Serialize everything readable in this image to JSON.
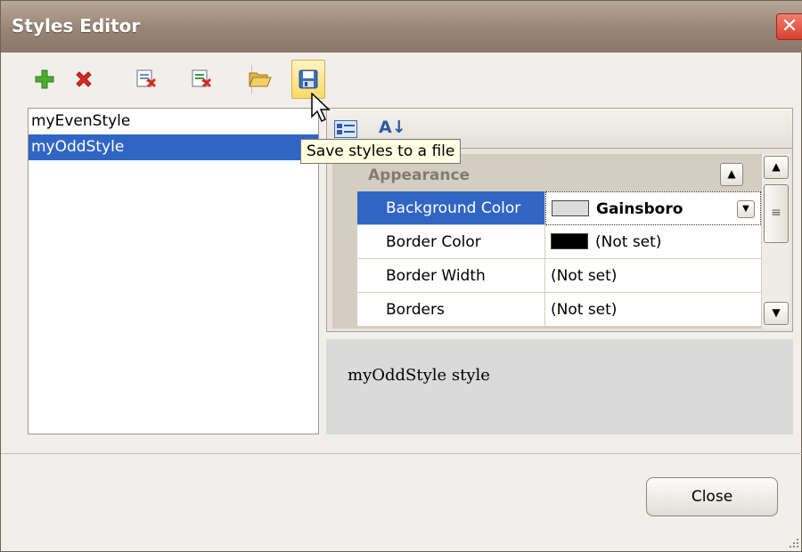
{
  "window": {
    "title": "Styles Editor",
    "close_glyph": "✕"
  },
  "toolbar": {
    "buttons": [
      {
        "name": "add-style",
        "icon": "plus-icon"
      },
      {
        "name": "delete-style",
        "icon": "red-x-icon"
      },
      {
        "name": "purge-styles",
        "icon": "purge-icon"
      },
      {
        "name": "clear-styles",
        "icon": "clear-icon"
      },
      {
        "name": "load-styles",
        "icon": "open-folder-icon"
      },
      {
        "name": "save-styles",
        "icon": "floppy-disk-icon"
      }
    ]
  },
  "style_list": {
    "items": [
      "myEvenStyle",
      "myOddStyle"
    ],
    "selected": "myOddStyle"
  },
  "property_grid": {
    "toolbar": {
      "categorized_icon": "categorized-icon",
      "alphabetical_label": "A↓"
    },
    "category": "Appearance",
    "rows": [
      {
        "name": "Background Color",
        "value": "Gainsboro",
        "swatch": "#dcdcdc",
        "selected": true
      },
      {
        "name": "Border Color",
        "value": "(Not set)",
        "swatch": "#000000"
      },
      {
        "name": "Border Width",
        "value": "(Not set)"
      },
      {
        "name": "Borders",
        "value": "(Not set)"
      }
    ]
  },
  "description": {
    "text": "myOddStyle style"
  },
  "tooltip": {
    "text": "Save styles to a file"
  },
  "footer": {
    "close_label": "Close"
  },
  "colors": {
    "selection": "#3165c4",
    "titlebar": "#978474",
    "tooltip_bg": "#ffffe1"
  }
}
